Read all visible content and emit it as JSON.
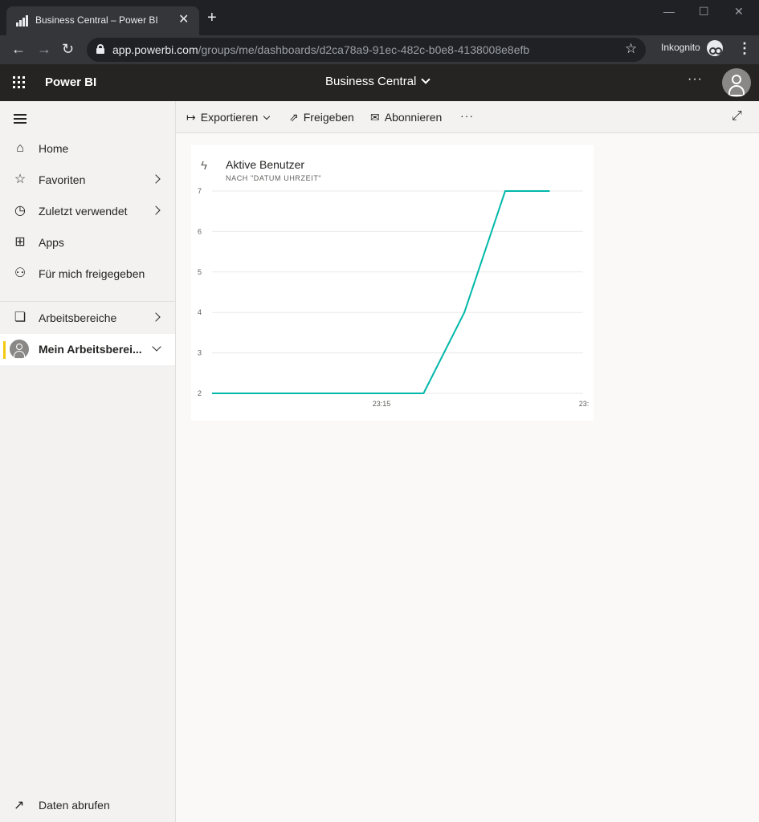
{
  "browser": {
    "tab_title": "Business Central – Power BI",
    "new_tab": "+",
    "url_host": "app.powerbi.com",
    "url_path": "/groups/me/dashboards/d2ca78a9-91ec-482c-b0e8-4138008e8efb",
    "incognito_label": "Inkognito"
  },
  "header": {
    "brand": "Power BI",
    "workspace": "Business Central",
    "more": "···"
  },
  "nav": {
    "items": [
      {
        "label": "Home",
        "icon": "home-icon"
      },
      {
        "label": "Favoriten",
        "icon": "star-icon"
      },
      {
        "label": "Zuletzt verwendet",
        "icon": "clock-icon"
      },
      {
        "label": "Apps",
        "icon": "apps-icon"
      },
      {
        "label": "Für mich freigegeben",
        "icon": "shared-icon"
      },
      {
        "label": "Arbeitsbereiche",
        "icon": "workspaces-icon"
      },
      {
        "label": "Mein Arbeitsberei...",
        "icon": "user-avatar"
      }
    ],
    "get_data": "Daten abrufen",
    "accent": "#f2c811"
  },
  "toolbar": {
    "export": "Exportieren",
    "share": "Freigeben",
    "subscribe": "Abonnieren",
    "more": "···"
  },
  "tile": {
    "title": "Aktive Benutzer",
    "subtitle": "NACH \"DATUM UHRZEIT\""
  },
  "chart_data": {
    "type": "line",
    "title": "Aktive Benutzer",
    "subtitle": "NACH \"DATUM UHRZEIT\"",
    "xlabel": "",
    "ylabel": "",
    "ylim": [
      2,
      7
    ],
    "yticks": [
      2,
      3,
      4,
      5,
      6,
      7
    ],
    "xticks": [
      "23:15",
      "23:"
    ],
    "grid": true,
    "color": "#01b8aa",
    "series": [
      {
        "points": [
          {
            "x": 0.0,
            "y": 2
          },
          {
            "x": 0.57,
            "y": 2
          },
          {
            "x": 0.68,
            "y": 4
          },
          {
            "x": 0.79,
            "y": 7
          },
          {
            "x": 0.91,
            "y": 7
          }
        ]
      }
    ]
  }
}
